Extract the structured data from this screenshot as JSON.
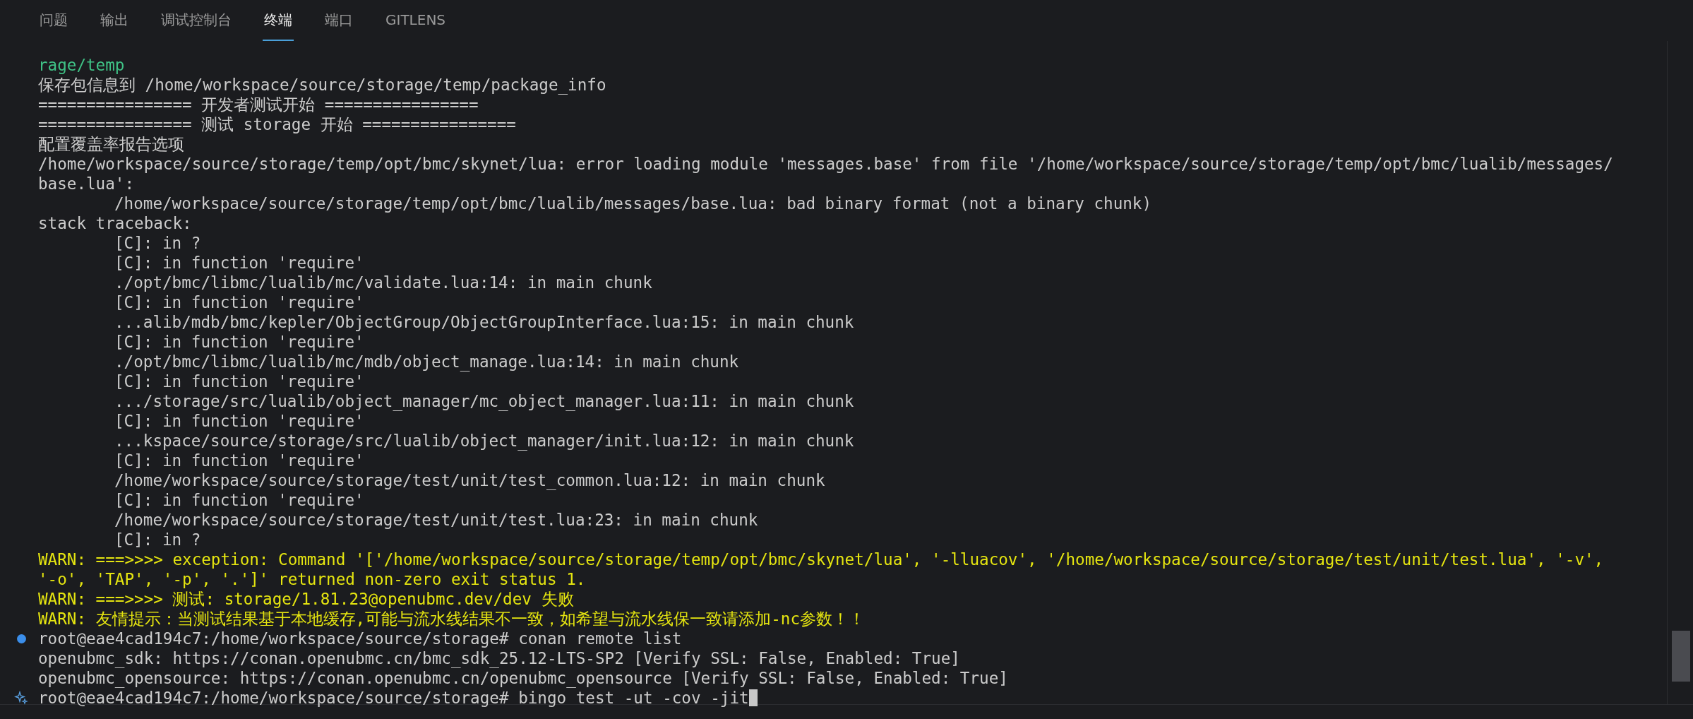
{
  "tabs": [
    {
      "label": "问题",
      "selected": false
    },
    {
      "label": "输出",
      "selected": false
    },
    {
      "label": "调试控制台",
      "selected": false
    },
    {
      "label": "终端",
      "selected": true
    },
    {
      "label": "端口",
      "selected": false
    },
    {
      "label": "GITLENS",
      "selected": false
    }
  ],
  "terminal": {
    "lines": [
      {
        "kind": "success",
        "text": "rage/temp"
      },
      {
        "kind": "plain",
        "text": "保存包信息到 /home/workspace/source/storage/temp/package_info"
      },
      {
        "kind": "plain",
        "text": "================ 开发者测试开始 ================"
      },
      {
        "kind": "plain",
        "text": "================ 测试 storage 开始 ================"
      },
      {
        "kind": "plain",
        "text": "配置覆盖率报告选项"
      },
      {
        "kind": "plain",
        "text": "/home/workspace/source/storage/temp/opt/bmc/skynet/lua: error loading module 'messages.base' from file '/home/workspace/source/storage/temp/opt/bmc/lualib/messages/"
      },
      {
        "kind": "plain",
        "text": "base.lua':"
      },
      {
        "kind": "indented",
        "text": "/home/workspace/source/storage/temp/opt/bmc/lualib/messages/base.lua: bad binary format (not a binary chunk)"
      },
      {
        "kind": "plain",
        "text": "stack traceback:"
      },
      {
        "kind": "indented",
        "text": "[C]: in ?"
      },
      {
        "kind": "indented",
        "text": "[C]: in function 'require'"
      },
      {
        "kind": "indented",
        "text": "./opt/bmc/libmc/lualib/mc/validate.lua:14: in main chunk"
      },
      {
        "kind": "indented",
        "text": "[C]: in function 'require'"
      },
      {
        "kind": "indented",
        "text": "...alib/mdb/bmc/kepler/ObjectGroup/ObjectGroupInterface.lua:15: in main chunk"
      },
      {
        "kind": "indented",
        "text": "[C]: in function 'require'"
      },
      {
        "kind": "indented",
        "text": "./opt/bmc/libmc/lualib/mc/mdb/object_manage.lua:14: in main chunk"
      },
      {
        "kind": "indented",
        "text": "[C]: in function 'require'"
      },
      {
        "kind": "indented",
        "text": ".../storage/src/lualib/object_manager/mc_object_manager.lua:11: in main chunk"
      },
      {
        "kind": "indented",
        "text": "[C]: in function 'require'"
      },
      {
        "kind": "indented",
        "text": "...kspace/source/storage/src/lualib/object_manager/init.lua:12: in main chunk"
      },
      {
        "kind": "indented",
        "text": "[C]: in function 'require'"
      },
      {
        "kind": "indented",
        "text": "/home/workspace/source/storage/test/unit/test_common.lua:12: in main chunk"
      },
      {
        "kind": "indented",
        "text": "[C]: in function 'require'"
      },
      {
        "kind": "indented",
        "text": "/home/workspace/source/storage/test/unit/test.lua:23: in main chunk"
      },
      {
        "kind": "indented",
        "text": "[C]: in ?"
      },
      {
        "kind": "warn",
        "text": "WARN: ===>>>> exception: Command '['/home/workspace/source/storage/temp/opt/bmc/skynet/lua', '-lluacov', '/home/workspace/source/storage/test/unit/test.lua', '-v',"
      },
      {
        "kind": "warn",
        "text": "'-o', 'TAP', '-p', '.']' returned non-zero exit status 1."
      },
      {
        "kind": "warn",
        "text": "WARN: ===>>>> 测试: storage/1.81.23@openubmc.dev/dev 失败"
      },
      {
        "kind": "warn",
        "text": "WARN: 友情提示：当测试结果基于本地缓存,可能与流水线结果不一致，如希望与流水线保一致请添加-nc参数！！"
      },
      {
        "kind": "command",
        "text": "root@eae4cad194c7:/home/workspace/source/storage# conan remote list"
      },
      {
        "kind": "plain",
        "text": "openubmc_sdk: https://conan.openubmc.cn/bmc_sdk_25.12-LTS-SP2 [Verify SSL: False, Enabled: True]"
      },
      {
        "kind": "plain",
        "text": "openubmc_opensource: https://conan.openubmc.cn/openubmc_opensource [Verify SSL: False, Enabled: True]"
      },
      {
        "kind": "input",
        "text": "root@eae4cad194c7:/home/workspace/source/storage# bingo test -ut -cov -jit"
      }
    ]
  }
}
